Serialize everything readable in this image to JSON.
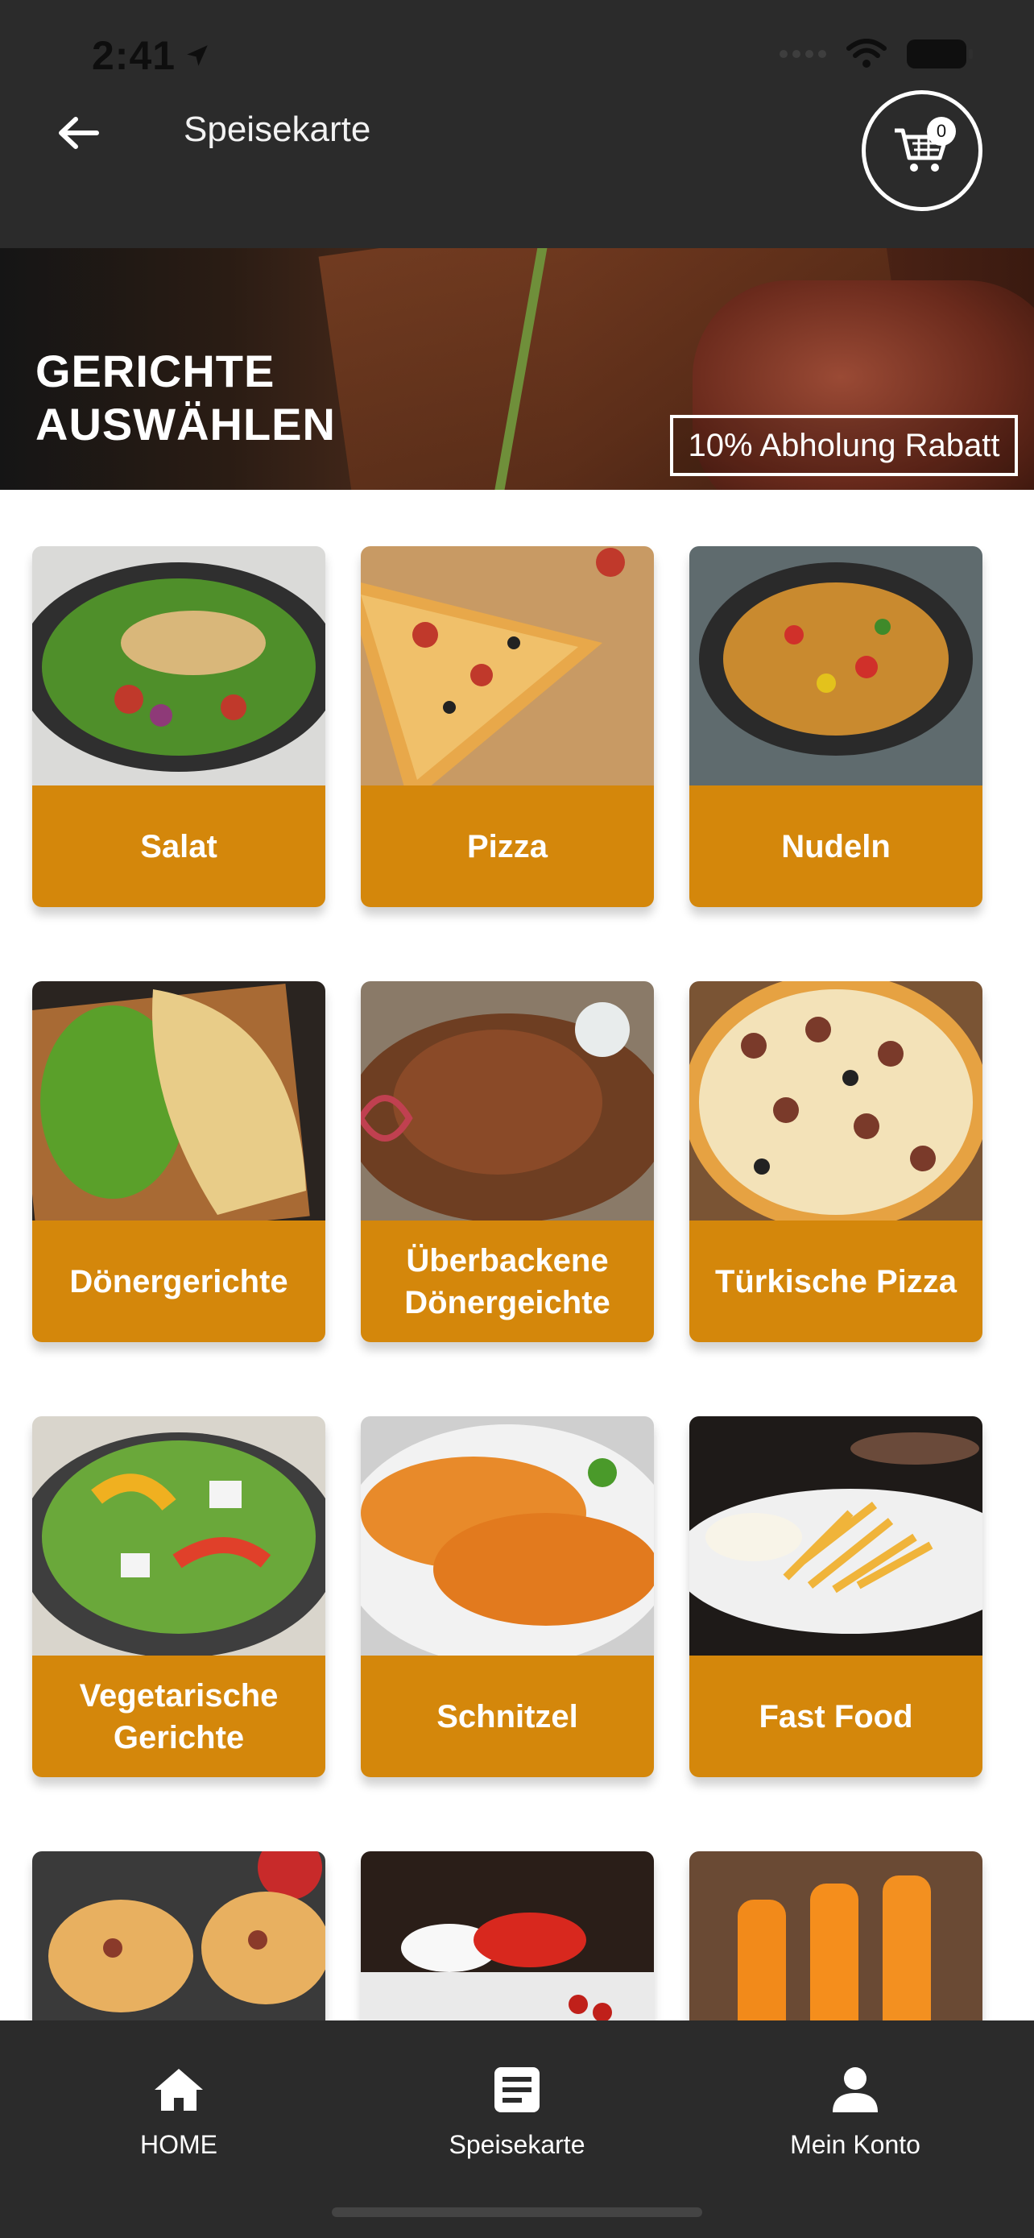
{
  "status_bar": {
    "time": "2:41"
  },
  "header": {
    "title": "Speisekarte",
    "cart_count": "0"
  },
  "banner": {
    "title_line1": "GERICHTE",
    "title_line2": "AUSWÄHLEN",
    "badge": "10% Abholung Rabatt"
  },
  "categories": [
    {
      "label": "Salat"
    },
    {
      "label": "Pizza"
    },
    {
      "label": "Nudeln"
    },
    {
      "label": "Dönergerichte"
    },
    {
      "label": "Überbackene Dönergeichte"
    },
    {
      "label": "Türkische Pizza"
    },
    {
      "label": "Vegetarische Gerichte"
    },
    {
      "label": "Schnitzel"
    },
    {
      "label": "Fast Food"
    },
    {
      "label": ""
    },
    {
      "label": ""
    },
    {
      "label": ""
    }
  ],
  "bottom_nav": {
    "home": "HOME",
    "menu": "Speisekarte",
    "account": "Mein Konto"
  },
  "colors": {
    "accent": "#d4870b",
    "bar": "#2b2b2b"
  }
}
